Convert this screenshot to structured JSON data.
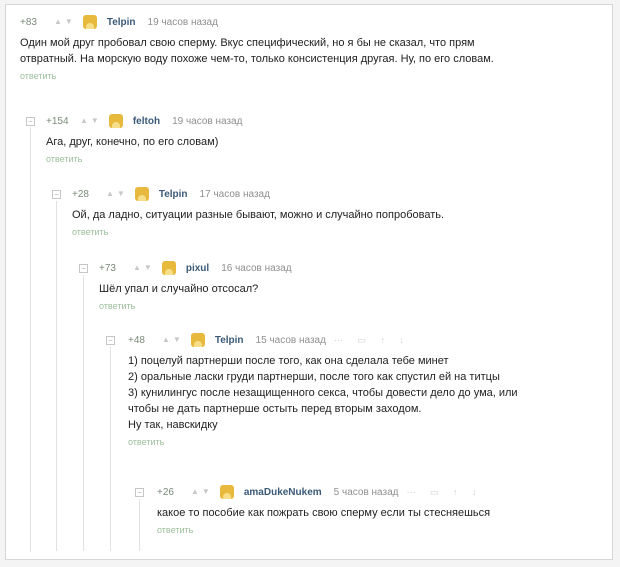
{
  "comments": [
    {
      "score": "+83",
      "user": "Telpin",
      "time": "19 часов назад",
      "lines": [
        "Один мой друг пробовал свою сперму. Вкус специфический, но я бы не сказал, что прям",
        "отвратный. На морскую воду похоже чем-то, только консистенция другая. Ну, по его словам."
      ],
      "reply": "ответить"
    },
    {
      "score": "+154",
      "user": "feltoh",
      "time": "19 часов назад",
      "lines": [
        "Ага, друг, конечно, по его словам)"
      ],
      "reply": "ответить"
    },
    {
      "score": "+28",
      "user": "Telpin",
      "time": "17 часов назад",
      "lines": [
        "Ой, да ладно, ситуации разные бывают, можно и случайно попробовать."
      ],
      "reply": "ответить"
    },
    {
      "score": "+73",
      "user": "pixul",
      "time": "16 часов назад",
      "lines": [
        "Шёл упал и случайно отсосал?"
      ],
      "reply": "ответить"
    },
    {
      "score": "+48",
      "user": "Telpin",
      "time": "15 часов назад",
      "lines": [
        "1) поцелуй партнерши после того, как она сделала тебе минет",
        "2) оральные ласки груди партнерши, после того как спустил ей на титцы",
        "3) кунилингус после незащищенного секса, чтобы довести дело до ума, или",
        "чтобы не дать партнерше остыть перед вторым заходом.",
        "Ну так, навскидку"
      ],
      "reply": "ответить"
    },
    {
      "score": "+26",
      "user": "amaDukeNukem",
      "time": "5 часов назад",
      "lines": [
        "какое то пособие как пожрать свою сперму если ты стесняешься"
      ],
      "reply": "ответить"
    }
  ],
  "ui": {
    "up_arrow": "▲",
    "down_arrow": "▼",
    "collapse_symbol": "−",
    "tools": "⋯ ▭ ↑ ↓"
  },
  "colors": {
    "username": "#3a5a78",
    "reply_link": "#9bbf9b",
    "avatar": "#e7b93c"
  }
}
